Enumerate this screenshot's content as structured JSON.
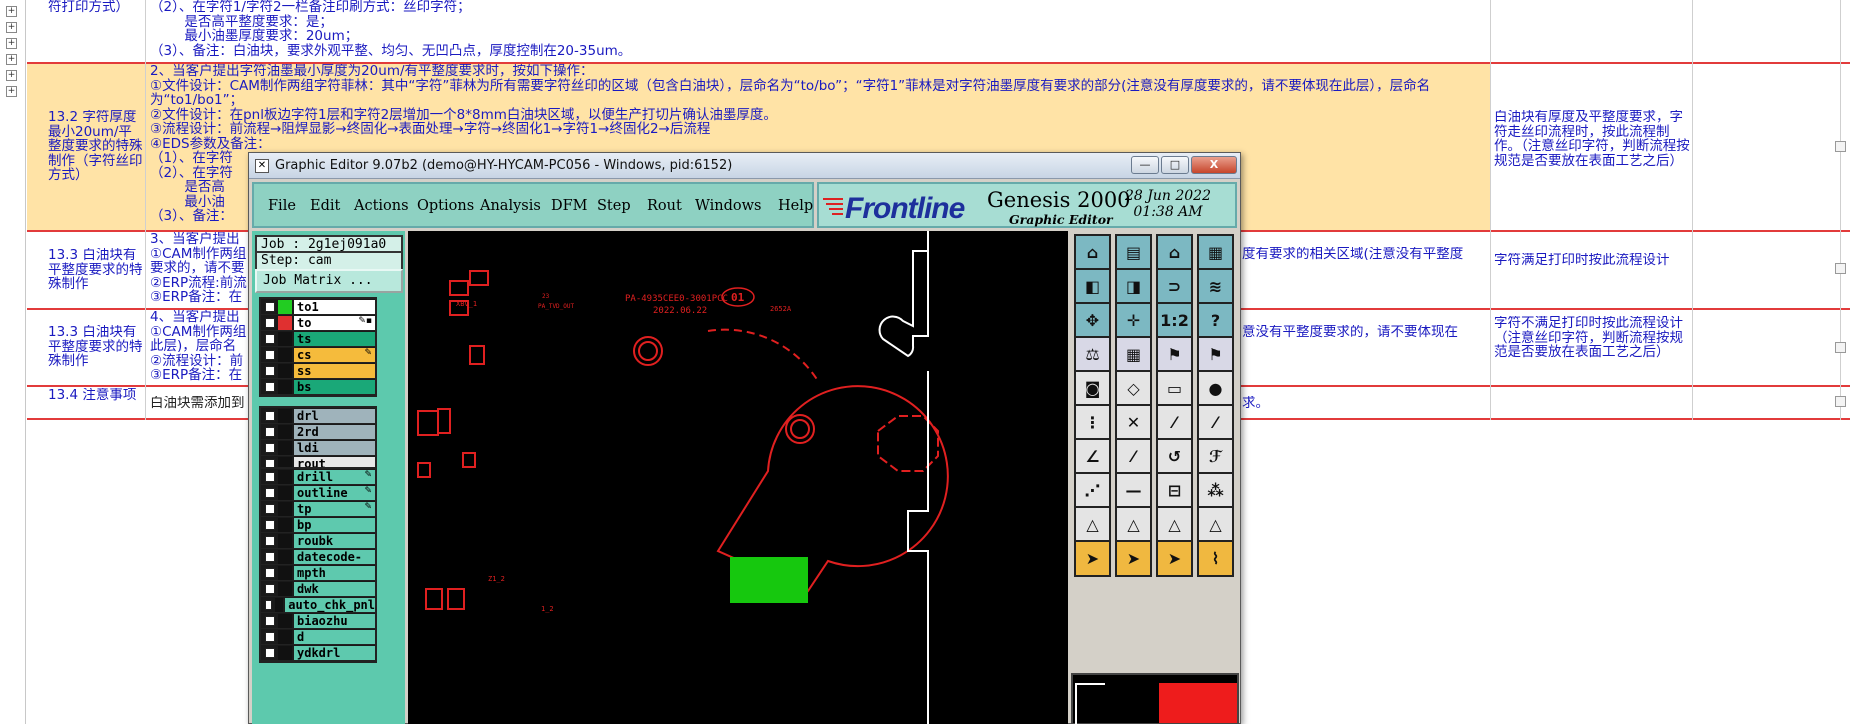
{
  "spreadsheet": {
    "rows": [
      {
        "label": "符打印方式）",
        "content": "（2）、在字符1/字符2一栏备注印刷方式：丝印字符；\n        是否高平整度要求：是；\n        最小油墨厚度要求：20um；\n（3）、备注：白油块，要求外观平整、均匀、无凹凸点，厚度控制在20-35um。",
        "note": ""
      },
      {
        "label": "13.2 字符厚度最小20um/平整度要求的特殊制作（字符丝印方式）",
        "content": "2、当客户提出字符油墨最小厚度为20um/有平整度要求时，按如下操作：\n①文件设计：CAM制作两组字符菲林：其中“字符”菲林为所有需要字符丝印的区域（包含白油块），层命名为“to/bo”；“字符1”菲林是对字符油墨厚度有要求的部分(注意没有厚度要求的，请不要体现在此层），层命名为“to1/bo1”；\n②文件设计：在pnl板边字符1层和字符2层增加一个8*8mm白油块区域，以便生产打切片确认油墨厚度。\n③流程设计：前流程→阻焊显影→终固化→表面处理→字符→终固化1→字符1→终固化2→后流程\n④EDS参数及备注：\n（1）、在字符\n（2）、在字符\n        是否高\n        最小油\n（3）、备注：",
        "note": "白油块有厚度及平整度要求，字符走丝印流程时，按此流程制作。（注意丝印字符，判断流程按规范是否要放在表面工艺之后）"
      },
      {
        "label": "13.3 白油块有平整度要求的特殊制作",
        "content": "3、当客户提出\n①CAM制作两组\n要求的，请不要\n②ERP流程:前流\n③ERP备注：在",
        "content_right": "度有要求的相关区域(注意没有平整度",
        "note": "字符满足打印时按此流程设计"
      },
      {
        "label": "13.3 白油块有平整度要求的特殊制作",
        "content": "4、当客户提出\n①CAM制作两组\n此层)，层命名\n②流程设计：前\n③ERP备注：在",
        "content_right": "意没有平整度要求的，请不要体现在",
        "note": "字符不满足打印时按此流程设计（注意丝印字符，判断流程按规范是否要放在表面工艺之后）"
      },
      {
        "label": "13.4 注意事项",
        "content": "白油块需添加到",
        "content_right": "求。",
        "note": ""
      }
    ]
  },
  "window": {
    "title": "Graphic Editor 9.07b2 (demo@HY-HYCAM-PC056 - Windows, pid:6152)",
    "controls": {
      "minimize": "—",
      "maximize": "□",
      "close": "X"
    }
  },
  "menu": [
    "File",
    "Edit",
    "Actions",
    "Options",
    "Analysis",
    "DFM",
    "Step",
    "Rout",
    "Windows",
    "Help"
  ],
  "brand": {
    "logo": "Frontline",
    "product": "Genesis 2000",
    "subtitle": "Graphic Editor",
    "date": "28 Jun 2022",
    "time": "01:38 AM"
  },
  "job": {
    "job_label": "Job : 2g1ej091a0",
    "step_label": "Step: cam",
    "matrix_button": "Job Matrix ..."
  },
  "layer_groups": [
    [
      {
        "name": "to1",
        "bg": "#ffffff",
        "swatch": "#22cc22",
        "flag": ""
      },
      {
        "name": "to",
        "bg": "#ffffff",
        "swatch": "#e03030",
        "flag": "✎▪"
      },
      {
        "name": "ts",
        "bg": "#1aa878",
        "swatch": "#111111",
        "flag": ""
      },
      {
        "name": "cs",
        "bg": "#f5bb3c",
        "swatch": "#111111",
        "flag": "✎"
      },
      {
        "name": "ss",
        "bg": "#f5bb3c",
        "swatch": "#111111",
        "flag": ""
      },
      {
        "name": "bs",
        "bg": "#1aa878",
        "swatch": "#111111",
        "flag": ""
      }
    ],
    [
      {
        "name": "drl",
        "bg": "#9fb3bb",
        "swatch": "#111111",
        "flag": ""
      },
      {
        "name": "2rd",
        "bg": "#9fb3bb",
        "swatch": "#111111",
        "flag": ""
      },
      {
        "name": "ldi",
        "bg": "#9fb3bb",
        "swatch": "#111111",
        "flag": ""
      },
      {
        "name": "rout",
        "bg": "#e8e8e8",
        "swatch": "#111111",
        "flag": ""
      }
    ],
    [
      {
        "name": "drill",
        "bg": "#5ec9ae",
        "swatch": "#111111",
        "flag": "✎"
      },
      {
        "name": "outline",
        "bg": "#5ec9ae",
        "swatch": "#111111",
        "flag": "✎"
      },
      {
        "name": "tp",
        "bg": "#5ec9ae",
        "swatch": "#111111",
        "flag": "✎"
      },
      {
        "name": "bp",
        "bg": "#5ec9ae",
        "swatch": "#111111",
        "flag": ""
      },
      {
        "name": "roubk",
        "bg": "#5ec9ae",
        "swatch": "#111111",
        "flag": ""
      },
      {
        "name": "datecode-to",
        "bg": "#5ec9ae",
        "swatch": "#111111",
        "flag": ""
      },
      {
        "name": "mpth",
        "bg": "#5ec9ae",
        "swatch": "#111111",
        "flag": ""
      },
      {
        "name": "dwk",
        "bg": "#5ec9ae",
        "swatch": "#111111",
        "flag": ""
      },
      {
        "name": "auto_chk_pnl",
        "bg": "#5ec9ae",
        "swatch": "#111111",
        "flag": ""
      },
      {
        "name": "biaozhu",
        "bg": "#5ec9ae",
        "swatch": "#111111",
        "flag": ""
      },
      {
        "name": "d",
        "bg": "#5ec9ae",
        "swatch": "#111111",
        "flag": ""
      },
      {
        "name": "ydkdrl",
        "bg": "#5ec9ae",
        "swatch": "#111111",
        "flag": ""
      }
    ]
  ],
  "canvas_text": {
    "part_no": "PA-4935CEE0-3001PCC",
    "date": "2022.06.22",
    "circle_label": "01",
    "small_a": "XBV_1",
    "small_b": "PA_TVD_OUT",
    "small_c": "23",
    "small_d": "2652A",
    "small_e": "Z1_2",
    "small_f": "1_2"
  },
  "tools": [
    {
      "name": "home-tool-icon",
      "glyph": "⌂"
    },
    {
      "name": "export-tool-icon",
      "glyph": "▤"
    },
    {
      "name": "house-tool-icon",
      "glyph": "⌂"
    },
    {
      "name": "window-tool-icon",
      "glyph": "▦"
    },
    {
      "name": "arrow-left-tool-icon",
      "glyph": "◧"
    },
    {
      "name": "arrow-right-tool-icon",
      "glyph": "◨"
    },
    {
      "name": "step-tool-icon",
      "glyph": "⊃"
    },
    {
      "name": "snap-tool-icon",
      "glyph": "≋"
    },
    {
      "name": "fit-tool-icon",
      "glyph": "✥"
    },
    {
      "name": "pan-tool-icon",
      "glyph": "✛"
    },
    {
      "name": "zoom-1to2-tool-icon",
      "glyph": "1:2"
    },
    {
      "name": "help-tool-icon",
      "glyph": "?"
    },
    {
      "name": "measure-tool-icon",
      "glyph": "⚖"
    },
    {
      "name": "grid-tool-icon",
      "glyph": "▦"
    },
    {
      "name": "layers-tool-icon",
      "glyph": "⚑"
    },
    {
      "name": "layers2-tool-icon",
      "glyph": "⚑"
    },
    {
      "name": "pad-tool-icon",
      "glyph": "◙"
    },
    {
      "name": "shape-tool-icon",
      "glyph": "◇"
    },
    {
      "name": "ruler-tool-icon",
      "glyph": "▭"
    },
    {
      "name": "dot-tool-icon",
      "glyph": "●"
    },
    {
      "name": "connect-tool-icon",
      "glyph": "⋮"
    },
    {
      "name": "cross-tool-icon",
      "glyph": "✕"
    },
    {
      "name": "line-tool-icon",
      "glyph": "⁄"
    },
    {
      "name": "diag-tool-icon",
      "glyph": "⁄"
    },
    {
      "name": "angle-tool-icon",
      "glyph": "∠"
    },
    {
      "name": "slash-tool-icon",
      "glyph": "⁄"
    },
    {
      "name": "arc-tool-icon",
      "glyph": "↺"
    },
    {
      "name": "ff-tool-icon",
      "glyph": "ℱ"
    },
    {
      "name": "node-tool-icon",
      "glyph": "⋰"
    },
    {
      "name": "hline-tool-icon",
      "glyph": "—"
    },
    {
      "name": "bracket-tool-icon",
      "glyph": "⊟"
    },
    {
      "name": "cluster-tool-icon",
      "glyph": "⁂"
    },
    {
      "name": "tri1-tool-icon",
      "glyph": "△"
    },
    {
      "name": "tri2-tool-icon",
      "glyph": "△"
    },
    {
      "name": "tri3-tool-icon",
      "glyph": "△"
    },
    {
      "name": "tri4-tool-icon",
      "glyph": "△"
    },
    {
      "name": "select-tool-icon",
      "glyph": "➤"
    },
    {
      "name": "select2-tool-icon",
      "glyph": "➤"
    },
    {
      "name": "select3-tool-icon",
      "glyph": "➤"
    },
    {
      "name": "route-tool-icon",
      "glyph": "⌇"
    }
  ]
}
